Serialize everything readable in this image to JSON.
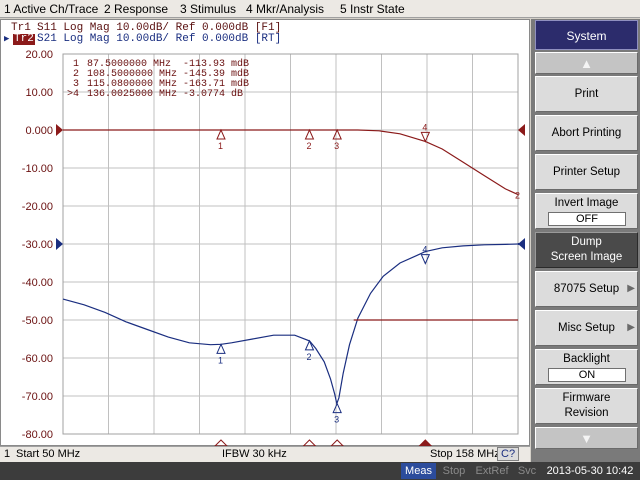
{
  "menu": [
    "1 Active Ch/Trace",
    "2 Response",
    "3 Stimulus",
    "4 Mkr/Analysis",
    "5 Instr State"
  ],
  "trace_header": {
    "tr1_tag": "Tr1",
    "tr1_text": "S11  Log Mag 10.00dB/ Ref 0.000dB [F1]",
    "tr2_tag": "Tr2",
    "tr2_text": "S21  Log Mag 10.00dB/ Ref 0.000dB [RT]"
  },
  "markers_table": [
    {
      "id": "1",
      "freq": "87.5000000 MHz",
      "value": "-113.93 mdB"
    },
    {
      "id": "2",
      "freq": "108.5000000 MHz",
      "value": "-145.39 mdB"
    },
    {
      "id": "3",
      "freq": "115.0800000 MHz",
      "value": "-163.71 mdB"
    },
    {
      "id": ">4",
      "freq": "136.0025000 MHz",
      "value": "-3.0774 dB"
    }
  ],
  "chart_data": {
    "type": "line",
    "ylim": [
      -80,
      20
    ],
    "xlim_mhz": [
      50,
      158
    ],
    "y_ticks": [
      "20.00",
      "10.00",
      "0.000",
      "-10.00",
      "-20.00",
      "-30.00",
      "-40.00",
      "-50.00",
      "-60.00",
      "-70.00",
      "-80.00"
    ],
    "y_tick_values": [
      20,
      10,
      0,
      -10,
      -20,
      -30,
      -40,
      -50,
      -60,
      -70,
      -80
    ],
    "grid": true,
    "series": [
      {
        "color": "#8b1a1a",
        "x": [
          50,
          70,
          90,
          110,
          120,
          125,
          130,
          136,
          140,
          145,
          150,
          155,
          158
        ],
        "y": [
          0,
          0,
          0,
          0,
          0,
          -0.2,
          -1.0,
          -3.0,
          -5.0,
          -8.5,
          -12.0,
          -15.5,
          -17.0
        ]
      },
      {
        "color": "#1a2e80",
        "x": [
          50,
          55,
          60,
          65,
          70,
          75,
          80,
          85,
          87.5,
          90,
          95,
          100,
          105,
          108.5,
          110,
          112,
          113.5,
          114.5,
          115,
          115.5,
          116.5,
          118,
          120,
          123,
          126,
          130,
          134,
          136,
          140,
          145,
          150,
          155,
          158
        ],
        "y": [
          -44.5,
          -46.0,
          -48.0,
          -50.5,
          -52.5,
          -54.5,
          -56.0,
          -56.5,
          -56.4,
          -56.0,
          -55.0,
          -54.0,
          -54.0,
          -55.5,
          -57.5,
          -61.0,
          -65.5,
          -69.5,
          -72.0,
          -70.5,
          -64.0,
          -56.5,
          -49.5,
          -43.0,
          -38.5,
          -35.0,
          -33.0,
          -32.0,
          -31.0,
          -30.5,
          -30.2,
          -30.1,
          -30.0
        ]
      }
    ],
    "limit_line": {
      "x": [
        119,
        158
      ],
      "y": -50,
      "color": "#8b1a1a"
    },
    "markers": [
      {
        "id": "1",
        "x": 87.5,
        "y_s21": -56.4
      },
      {
        "id": "2",
        "x": 108.5,
        "y_s21": -55.5
      },
      {
        "id": "3",
        "x": 115.08,
        "y_s21": -72.0
      },
      {
        "id": "4",
        "x": 136.0025,
        "y_s21": -32.0
      }
    ],
    "end_label": "2"
  },
  "status": {
    "channel": "1",
    "start": "Start 50 MHz",
    "ifbw": "IFBW 30 kHz",
    "stop": "Stop 158 MHz",
    "c_flag": "C?"
  },
  "bottom": {
    "meas": "Meas",
    "stop": "Stop",
    "extref": "ExtRef",
    "svc": "Svc",
    "datetime": "2013-05-30 10:42"
  },
  "softkeys": {
    "title": "System",
    "print": "Print",
    "abort": "Abort Printing",
    "printer_setup": "Printer Setup",
    "invert_label": "Invert Image",
    "invert_value": "OFF",
    "dump_1": "Dump",
    "dump_2": "Screen Image",
    "setup_87075": "87075 Setup",
    "misc_setup": "Misc Setup",
    "backlight_label": "Backlight",
    "backlight_value": "ON",
    "firmware_1": "Firmware",
    "firmware_2": "Revision"
  },
  "colors": {
    "s11": "#8b1a1a",
    "s21": "#1a2e80",
    "grid": "#c0c0c0",
    "softkey_title_bg": "#2c2c6c",
    "softkey_selected_bg": "#4a4a4a"
  }
}
